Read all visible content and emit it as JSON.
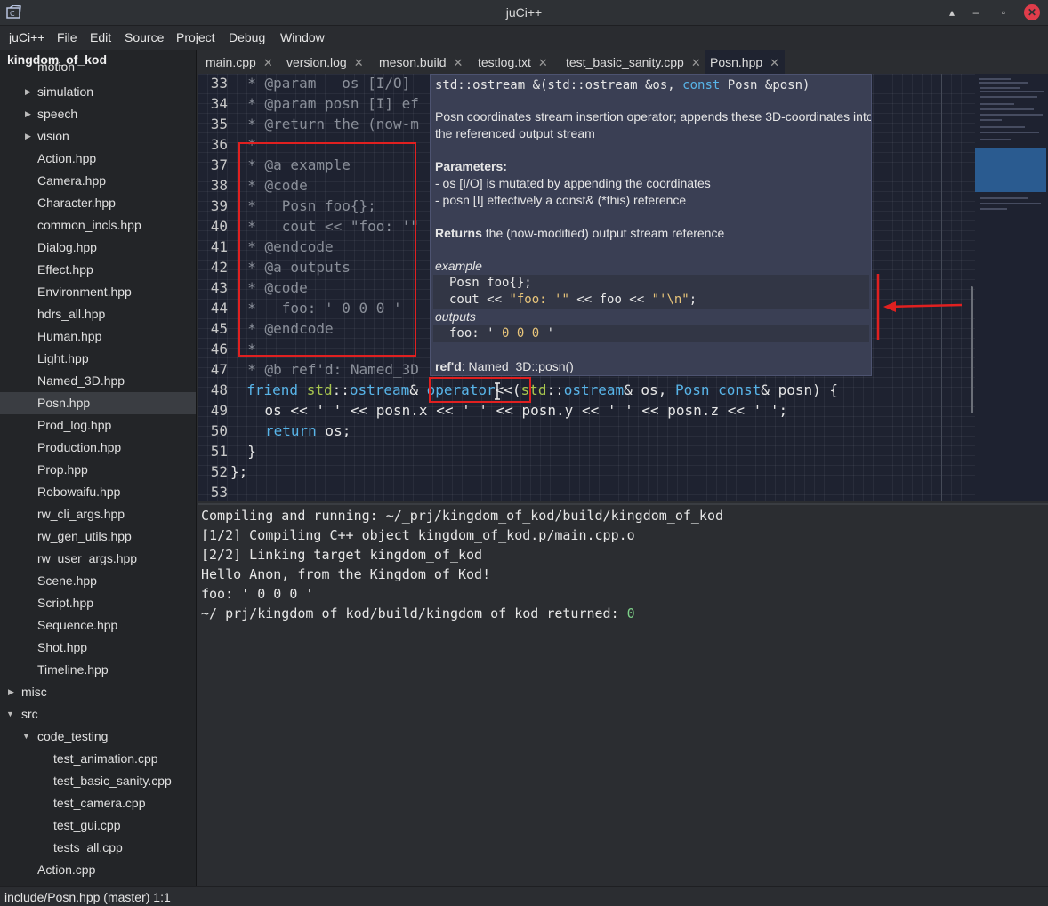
{
  "window": {
    "title": "juCi++",
    "controls": [
      "▴",
      "–",
      "▫",
      "✕"
    ]
  },
  "menubar": {
    "items": [
      "juCi++",
      "File",
      "Edit",
      "Source",
      "Project",
      "Debug",
      "Window"
    ]
  },
  "sidebar": {
    "project_title": "kingdom_of_kod",
    "items": [
      {
        "label": "motion",
        "folder": true
      },
      {
        "label": "simulation",
        "folder": true
      },
      {
        "label": "speech",
        "folder": true
      },
      {
        "label": "vision",
        "folder": true
      },
      {
        "label": "Action.hpp"
      },
      {
        "label": "Camera.hpp"
      },
      {
        "label": "Character.hpp"
      },
      {
        "label": "common_incls.hpp"
      },
      {
        "label": "Dialog.hpp"
      },
      {
        "label": "Effect.hpp"
      },
      {
        "label": "Environment.hpp"
      },
      {
        "label": "hdrs_all.hpp"
      },
      {
        "label": "Human.hpp"
      },
      {
        "label": "Light.hpp"
      },
      {
        "label": "Named_3D.hpp"
      },
      {
        "label": "Posn.hpp",
        "selected": true
      },
      {
        "label": "Prod_log.hpp"
      },
      {
        "label": "Production.hpp"
      },
      {
        "label": "Prop.hpp"
      },
      {
        "label": "Robowaifu.hpp"
      },
      {
        "label": "rw_cli_args.hpp"
      },
      {
        "label": "rw_gen_utils.hpp"
      },
      {
        "label": "rw_user_args.hpp"
      },
      {
        "label": "Scene.hpp"
      },
      {
        "label": "Script.hpp"
      },
      {
        "label": "Sequence.hpp"
      },
      {
        "label": "Shot.hpp"
      },
      {
        "label": "Timeline.hpp"
      },
      {
        "label": "misc",
        "folder": true
      },
      {
        "label": "src",
        "folder": true,
        "open": true
      },
      {
        "label": "code_testing",
        "folder": true,
        "open": true
      },
      {
        "label": "test_animation.cpp"
      },
      {
        "label": "test_basic_sanity.cpp"
      },
      {
        "label": "test_camera.cpp"
      },
      {
        "label": "test_gui.cpp"
      },
      {
        "label": "tests_all.cpp"
      },
      {
        "label": "Action.cpp"
      }
    ]
  },
  "tabs": [
    {
      "label": "main.cpp"
    },
    {
      "label": "version.log"
    },
    {
      "label": "meson.build"
    },
    {
      "label": "testlog.txt"
    },
    {
      "label": "test_basic_sanity.cpp"
    },
    {
      "label": "Posn.hpp",
      "active": true
    }
  ],
  "tab_close_glyph": "✕",
  "editor": {
    "line_numbers": [
      "33",
      "34",
      "35",
      "36",
      "37",
      "38",
      "39",
      "40",
      "41",
      "42",
      "43",
      "44",
      "45",
      "46",
      "47",
      "48",
      "49",
      "50",
      "51",
      "52",
      "53"
    ],
    "lines": {
      "l33": "  * @param   os [I/O]",
      "l34": "  * @param posn [I] ef",
      "l35": "  * @return the (now-m",
      "l36": "  *",
      "l37": "  * @a example",
      "l38": "  * @code",
      "l39": "  *   Posn foo{};",
      "l40": "  *   cout << \"foo: '\"",
      "l41": "  * @endcode",
      "l42": "  * @a outputs",
      "l43": "  * @code",
      "l44": "  *   foo: ' 0 0 0 '",
      "l45": "  * @endcode",
      "l46": "  *",
      "l47": "  * @b ref'd: Named_3D",
      "l48": {
        "a": "  friend ",
        "b": "std",
        "c": "::",
        "d": "ostream",
        "e": "& ",
        "f": "operator",
        "g": "<<(",
        "h": "std",
        "i": "::",
        "j": "ostream",
        "k": "& os, ",
        "l": "Posn",
        "m": " ",
        "n": "const",
        "o": "& posn) {"
      },
      "l49": "    os << ' ' << posn.x << ' ' << posn.y << ' ' << posn.z << ' ';",
      "l50": {
        "kw": "return",
        "rest": " os;"
      },
      "l51": "  }",
      "l52": "};",
      "l53": ""
    }
  },
  "tooltip": {
    "signature": {
      "a": "std::ostream &(std::ostream &os, ",
      "b": "const",
      "c": " Posn &posn)"
    },
    "description_1": "Posn coordinates stream insertion operator; appends these 3D-coordinates into",
    "description_2": "the referenced output stream",
    "params_heading": "Parameters:",
    "param_1": "- os [I/O] is mutated by appending the coordinates",
    "param_2": "- posn [I] effectively a const& (*this) reference",
    "returns_bold": "Returns",
    "returns_text": " the (now-modified) output stream reference",
    "example_heading": "example",
    "example_line_1": "Posn foo{};",
    "example_line_2": {
      "a": "cout << ",
      "b": "\"foo: '\"",
      "c": " << foo << ",
      "d": "\"'\\n\"",
      "e": ";"
    },
    "outputs_heading": "outputs",
    "output_line": {
      "a": "foo: ' ",
      "b": "0 0 0",
      "c": " '"
    },
    "refd_bold": "ref'd",
    "refd_text": ": Named_3D::posn()"
  },
  "terminal": {
    "lines": [
      "Compiling and running: ~/_prj/kingdom_of_kod/build/kingdom_of_kod",
      "[1/2] Compiling C++ object kingdom_of_kod.p/main.cpp.o",
      "[2/2] Linking target kingdom_of_kod",
      "Hello Anon, from the Kingdom of Kod!",
      "foo: ' 0 0 0 '"
    ],
    "last_line_prefix": "~/_prj/kingdom_of_kod/build/kingdom_of_kod returned: ",
    "last_line_code": "0"
  },
  "statusbar": {
    "text": "include/Posn.hpp (master) 1:1"
  },
  "colors": {
    "annotation": "#e02020",
    "keyword": "#58b4e8",
    "namespace": "#a8c64e",
    "comment": "#8a8f99"
  }
}
